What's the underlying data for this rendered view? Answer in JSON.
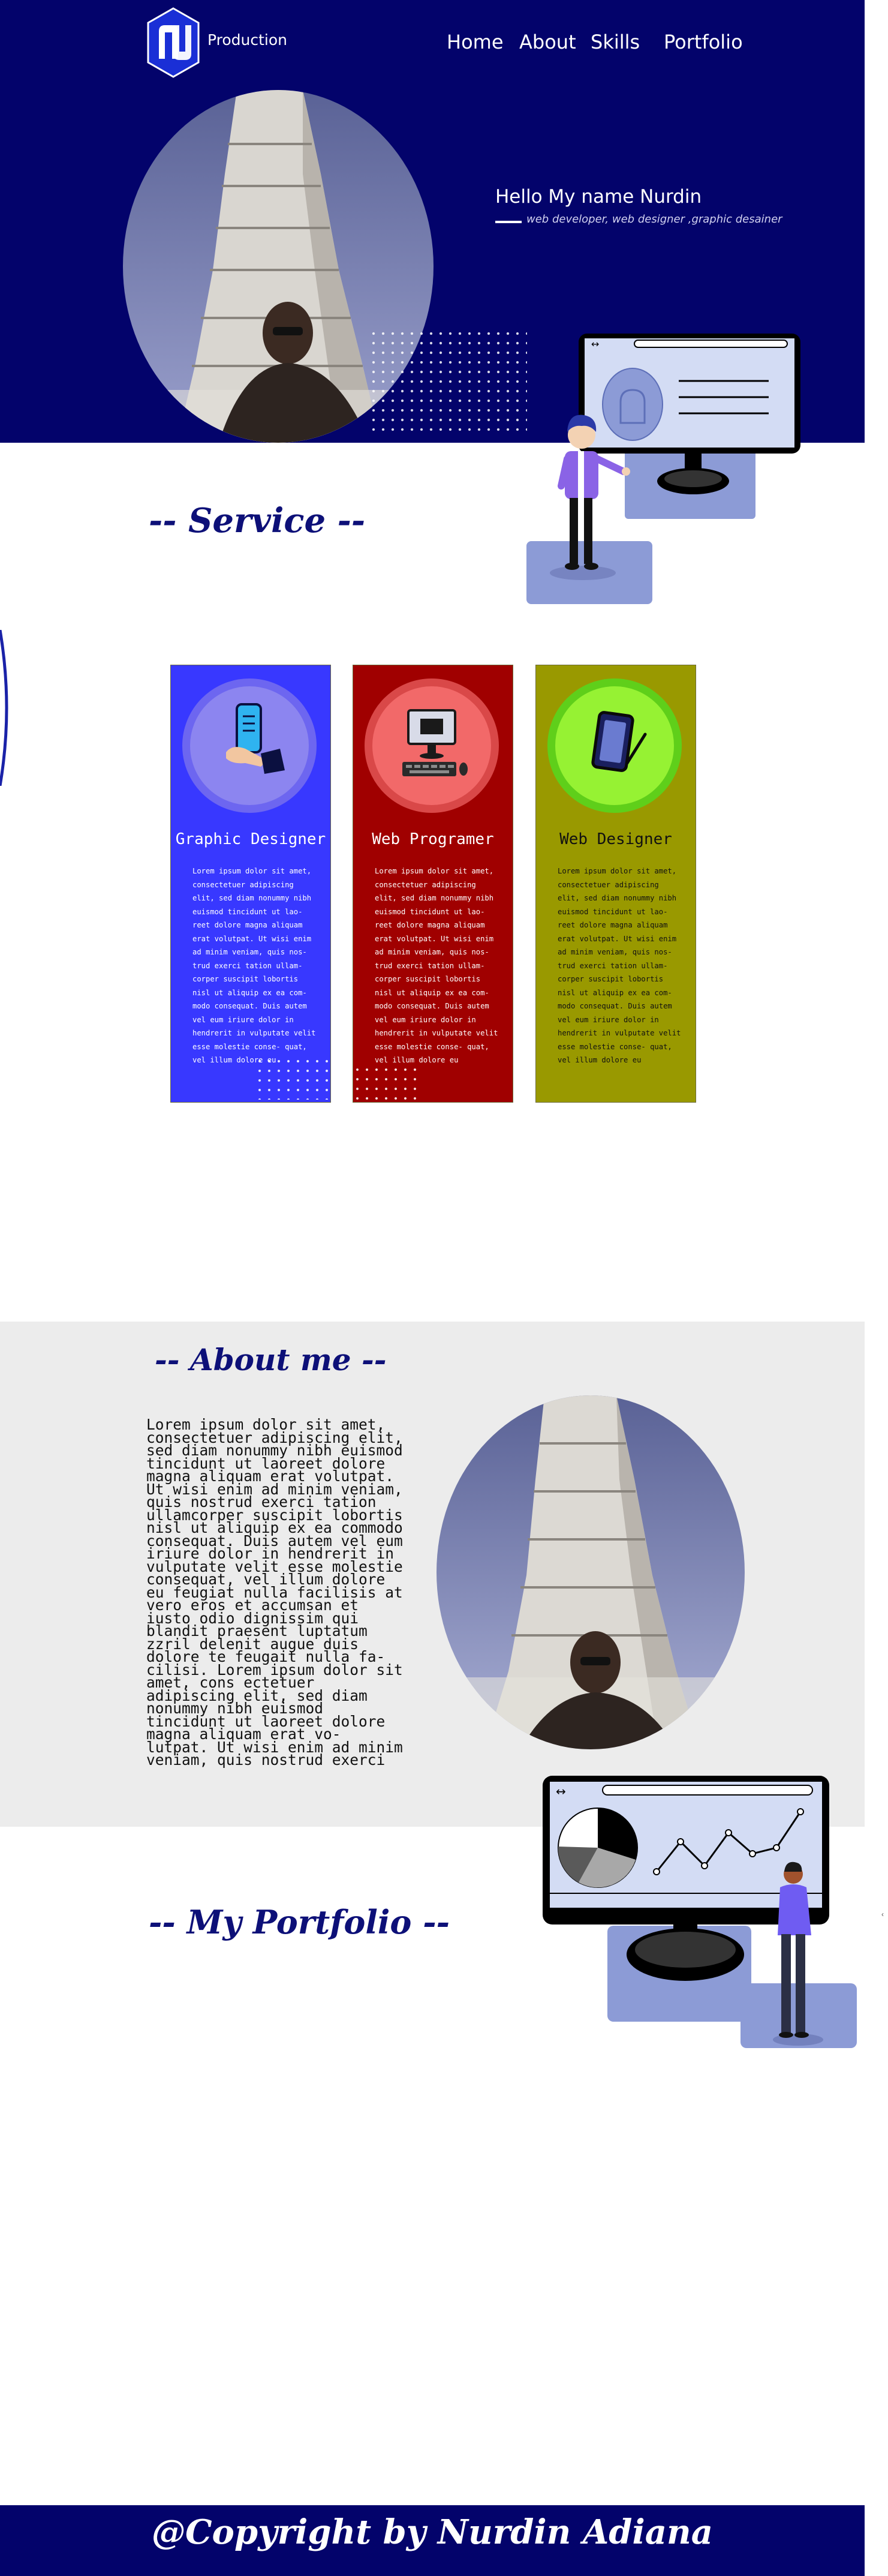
{
  "header": {
    "brand": "Production",
    "nav": [
      {
        "label": "Home"
      },
      {
        "label": "About"
      },
      {
        "label": "Skills"
      },
      {
        "label": "Portfolio"
      }
    ]
  },
  "hero": {
    "greeting": "Hello My name Nurdin",
    "tagline": "web developer, web designer ,graphic desainer"
  },
  "service": {
    "title": "-- Service --",
    "cards": [
      {
        "title": "Graphic Designer",
        "text": "Lorem ipsum dolor sit amet, consectetuer adipiscing elit, sed diam nonummy nibh euismod tincidunt ut lao- reet dolore magna aliquam erat volutpat. Ut wisi enim ad minim veniam, quis nos- trud exerci tation ullam- corper suscipit lobortis nisl ut aliquip ex ea com- modo consequat. Duis autem vel eum iriure dolor in hendrerit in vulputate velit esse molestie conse- quat, vel illum dolore eu"
      },
      {
        "title": "Web Programer",
        "text": "Lorem ipsum dolor sit amet, consectetuer adipiscing elit, sed diam nonummy nibh euismod tincidunt ut lao- reet dolore magna aliquam erat volutpat. Ut wisi enim ad minim veniam, quis nos- trud exerci tation ullam- corper suscipit lobortis nisl ut aliquip ex ea com- modo consequat. Duis autem vel eum iriure dolor in hendrerit in vulputate velit esse molestie conse- quat, vel illum dolore eu"
      },
      {
        "title": "Web Designer",
        "text": "Lorem ipsum dolor sit amet, consectetuer adipiscing elit, sed diam nonummy nibh euismod tincidunt ut lao- reet dolore magna aliquam erat volutpat. Ut wisi enim ad minim veniam, quis nos- trud exerci tation ullam- corper suscipit lobortis nisl ut aliquip ex ea com- modo consequat. Duis autem vel eum iriure dolor in hendrerit in vulputate velit esse molestie conse- quat, vel illum dolore eu"
      }
    ]
  },
  "about": {
    "title": "-- About me --",
    "text": "Lorem ipsum dolor sit amet, consectetuer adipiscing elit, sed diam nonummy nibh euismod tincidunt ut laoreet dolore magna aliquam erat volutpat. Ut wisi enim ad minim veniam, quis nostrud exerci tation ullamcorper suscipit lobortis nisl ut aliquip ex ea commodo consequat. Duis autem vel eum iriure dolor in hendrerit in vulputate velit esse molestie consequat, vel illum dolore eu feugiat nulla facilisis at vero eros et accumsan et iusto odio dignissim qui blandit praesent luptatum zzril delenit augue duis dolore te feugait nulla fa- cilisi. Lorem ipsum dolor sit amet, cons ectetuer adipiscing elit, sed diam nonummy nibh euismod tincidunt ut laoreet dolore magna aliquam erat vo- lutpat. Ut wisi enim ad minim veniam, quis nostrud exerci"
  },
  "portfolio": {
    "title": "-- My Portfolio --"
  },
  "footer": {
    "copyright": "@Copyright by Nurdin Adiana"
  },
  "colors": {
    "navy": "#03036b",
    "title_blue": "#0d1078",
    "card_blue": "#3838ff",
    "card_red": "#a00000",
    "card_olive": "#999900",
    "illustration_blue": "#8c9bd6",
    "about_bg": "#ececec"
  }
}
